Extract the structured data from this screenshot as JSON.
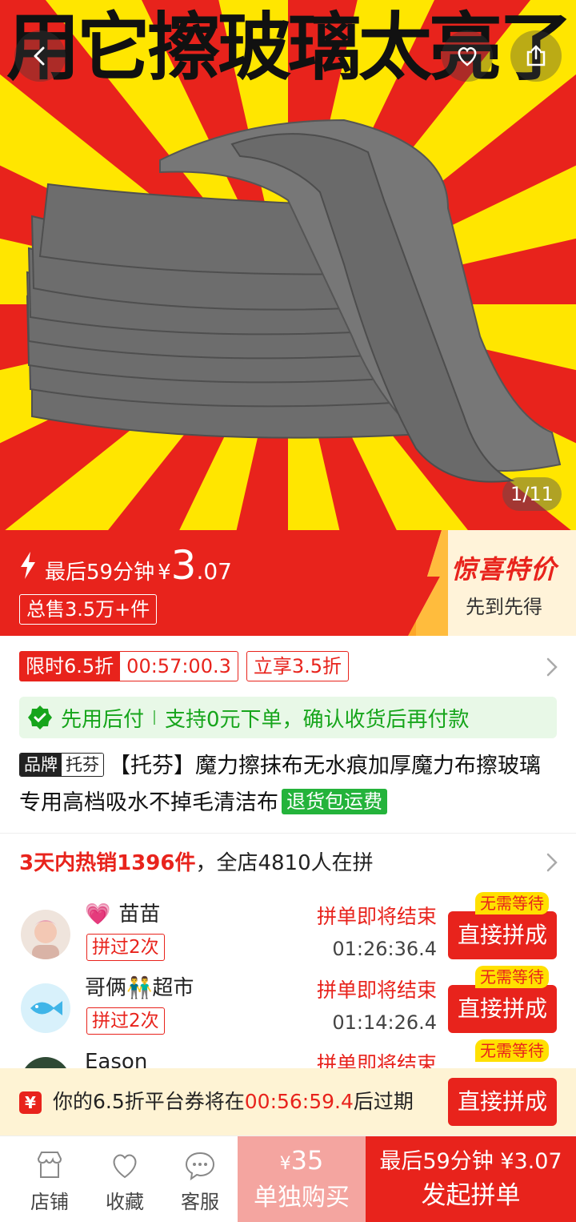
{
  "hero": {
    "banner_text": "用它擦玻璃太亮了",
    "image_counter": "1/11",
    "colors": {
      "ray_red": "#e8231c",
      "ray_yellow": "#ffe600",
      "towel": "#6e6e6e"
    }
  },
  "price_banner": {
    "flash_label": "最后59分钟",
    "currency": "¥",
    "price_int": "3",
    "price_dec": ".07",
    "sold": "总售3.5万+件",
    "promo_title": "惊喜特价",
    "promo_sub": "先到先得"
  },
  "coupon": {
    "limited_label": "限时6.5折",
    "countdown": "00:57:00.3",
    "instant_label": "立享3.5折"
  },
  "paylater": {
    "label": "先用后付",
    "desc": "支持0元下单，确认收货后再付款"
  },
  "product": {
    "brand_label": "品牌",
    "brand_name": "托芬",
    "title": "【托芬】魔力擦抹布无水痕加厚魔力布擦玻璃专用高档吸水不掉毛清洁布",
    "return_tag": "退货包运费"
  },
  "group_buy": {
    "hot_label": "3天内热销1396件",
    "store_label": "，全店4810人在拼",
    "members": [
      {
        "name": "苗苗",
        "tag": "拼过2次",
        "status": "拼单即将结束",
        "time": "01:26:36.4",
        "button": "直接拼成",
        "badge": "无需等待"
      },
      {
        "name": "哥俩👬超市",
        "tag": "拼过2次",
        "status": "拼单即将结束",
        "time": "01:14:26.4",
        "button": "直接拼成",
        "badge": "无需等待"
      },
      {
        "name": "Eason",
        "status": "拼单即将结束",
        "badge": "无需等待"
      }
    ]
  },
  "expiry_bar": {
    "icon_text": "¥",
    "prefix": "你的6.5折平台券将在",
    "countdown": "00:56:59.4",
    "suffix": "后过期",
    "button": "直接拼成"
  },
  "bottom_bar": {
    "store": "店铺",
    "favorite": "收藏",
    "service": "客服",
    "single_currency": "¥",
    "single_price": "35",
    "single_label": "单独购买",
    "group_price": "最后59分钟 ¥3.07",
    "group_label": "发起拼单"
  }
}
